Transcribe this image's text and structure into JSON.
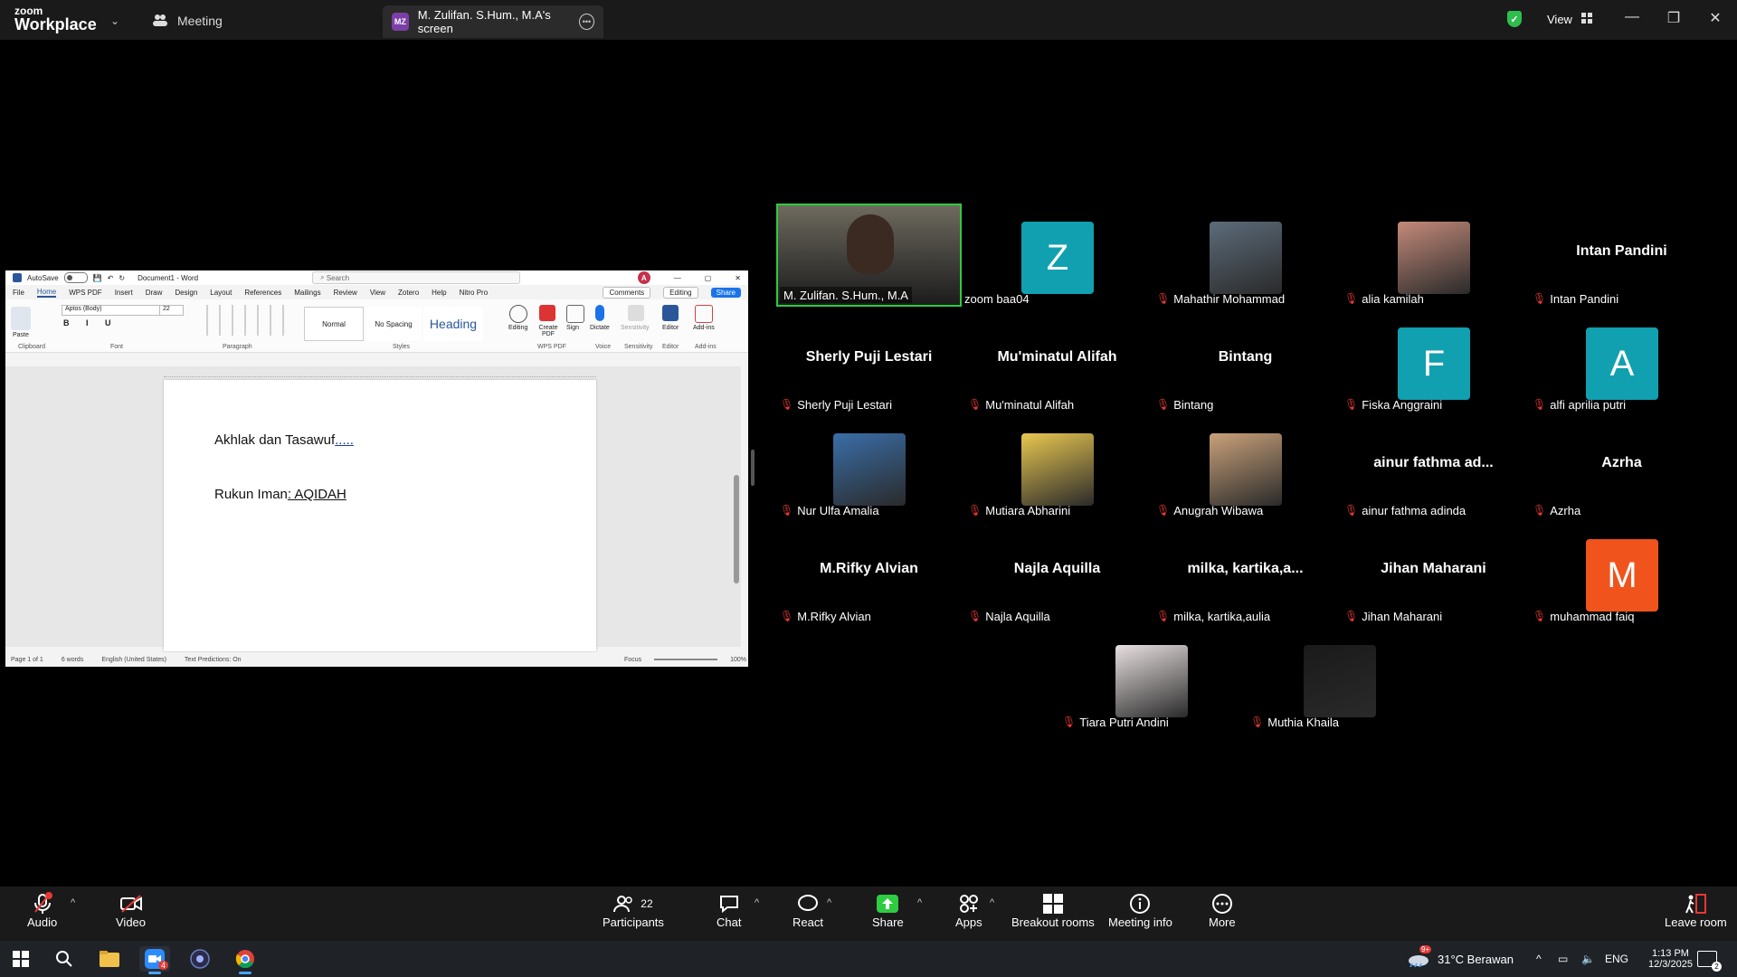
{
  "app": {
    "brand_line1": "zoom",
    "brand_line2": "Workplace"
  },
  "tabs": {
    "meeting": "Meeting",
    "screen_tab": "M. Zulifan. S.Hum., M.A's screen",
    "screen_initials": "MZ"
  },
  "header": {
    "view_label": "View"
  },
  "word": {
    "autosave": "AutoSave",
    "toggle": "Off",
    "doc_title": "Document1 - Word",
    "search": "Search",
    "avatar": "A",
    "menu": [
      "File",
      "Home",
      "WPS PDF",
      "Insert",
      "Draw",
      "Design",
      "Layout",
      "References",
      "Mailings",
      "Review",
      "View",
      "Zotero",
      "Help",
      "Nitro Pro"
    ],
    "comments": "Comments",
    "editing_mode": "Editing",
    "share": "Share",
    "font": "Aptos (Body)",
    "font_size": "22",
    "groups": {
      "clipboard": "Clipboard",
      "font": "Font",
      "paragraph": "Paragraph",
      "styles": "Styles",
      "wps": "WPS PDF",
      "voice": "Voice",
      "sensitivity": "Sensitivity",
      "editor": "Editor",
      "addins": "Add-ins"
    },
    "paste": "Paste",
    "style_normal": "Normal",
    "style_nospacing": "No Spacing",
    "style_heading": "Heading",
    "ribbon_tools": {
      "editing": "Editing",
      "create_pdf": "Create PDF",
      "sign": "Sign",
      "dictate": "Dictate",
      "sensitivity": "Sensitivity",
      "editor": "Editor",
      "addins": "Add-ins"
    },
    "line1_text": "Akhlak dan Tasawuf",
    "line1_dots": ".....",
    "line2_prefix": "Rukun Iman",
    "line2_suffix": ":  AQIDAH",
    "status": {
      "page": "Page 1 of 1",
      "words": "6 words",
      "language": "English (United States)",
      "predictions": "Text Predictions: On",
      "focus": "Focus",
      "zoom": "100%"
    }
  },
  "participants": [
    {
      "name": "M. Zulifan. S.Hum., M.A",
      "kind": "video",
      "muted": false,
      "speaker": true
    },
    {
      "name": "zoom baa04",
      "kind": "letter",
      "letter": "Z",
      "color": "#11a0b0",
      "muted": false
    },
    {
      "name": "Mahathir Mohammad",
      "kind": "photo",
      "muted": true
    },
    {
      "name": "alia kamilah",
      "kind": "photo",
      "muted": true
    },
    {
      "name": "Intan Pandini",
      "kind": "text",
      "center": "Intan Pandini",
      "muted": true
    },
    {
      "name": "Sherly Puji Lestari",
      "kind": "text",
      "center": "Sherly Puji Lestari",
      "muted": true
    },
    {
      "name": "Mu'minatul Alifah",
      "kind": "text",
      "center": "Mu'minatul Alifah",
      "muted": true
    },
    {
      "name": "Bintang",
      "kind": "text",
      "center": "Bintang",
      "muted": true
    },
    {
      "name": "Fiska Anggraini",
      "kind": "letter",
      "letter": "F",
      "color": "#11a0b0",
      "muted": true
    },
    {
      "name": "alfi aprilia putri",
      "kind": "letter",
      "letter": "A",
      "color": "#11a0b0",
      "muted": true
    },
    {
      "name": "Nur Ulfa Amalia",
      "kind": "photo",
      "muted": true
    },
    {
      "name": "Mutiara Abharini",
      "kind": "photo",
      "muted": true
    },
    {
      "name": "Anugrah Wibawa",
      "kind": "photo",
      "muted": true
    },
    {
      "name": "ainur fathma adinda",
      "kind": "text",
      "center": "ainur fathma ad...",
      "muted": true
    },
    {
      "name": "Azrha",
      "kind": "text",
      "center": "Azrha",
      "muted": true
    },
    {
      "name": "M.Rifky Alvian",
      "kind": "text",
      "center": "M.Rifky Alvian",
      "muted": true
    },
    {
      "name": "Najla Aquilla",
      "kind": "text",
      "center": "Najla Aquilla",
      "muted": true
    },
    {
      "name": "milka, kartika,aulia",
      "kind": "text",
      "center": "milka,  kartika,a...",
      "muted": true
    },
    {
      "name": "Jihan Maharani",
      "kind": "text",
      "center": "Jihan Maharani",
      "muted": true
    },
    {
      "name": "muhammad faiq",
      "kind": "letter",
      "letter": "M",
      "color": "#f0531c",
      "muted": true
    },
    {
      "name": "Tiara Putri Andini",
      "kind": "photo",
      "muted": true
    },
    {
      "name": "Muthia Khaila",
      "kind": "photo",
      "muted": true
    }
  ],
  "toolbar": {
    "audio": "Audio",
    "video": "Video",
    "participants": "Participants",
    "participants_count": "22",
    "chat": "Chat",
    "react": "React",
    "share": "Share",
    "apps": "Apps",
    "breakout": "Breakout rooms",
    "meeting_info": "Meeting info",
    "more": "More",
    "leave": "Leave room"
  },
  "taskbar": {
    "zoom_badge": "4",
    "weather": "31°C  Berawan",
    "weather_badge": "9+",
    "lang": "ENG",
    "time": "1:13 PM",
    "date": "12/3/2025",
    "notif": "2"
  }
}
